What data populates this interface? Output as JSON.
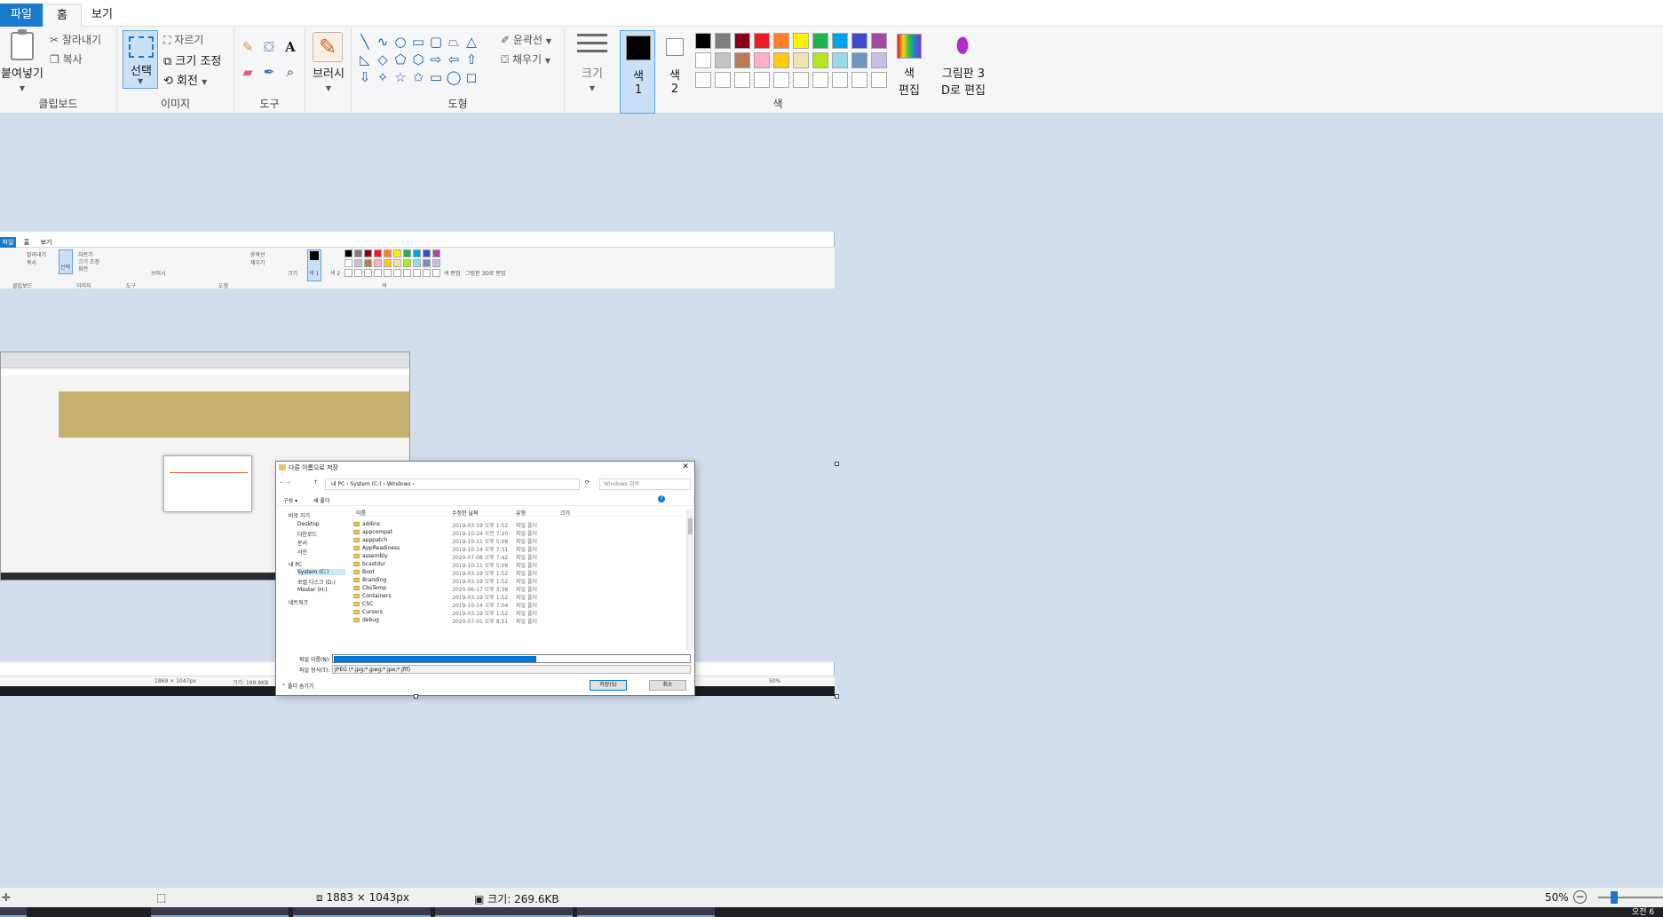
{
  "tabs": {
    "file": "파일",
    "home": "홈",
    "view": "보기"
  },
  "clipboard": {
    "paste": "붙여넣기",
    "cut": "잘라내기",
    "copy": "복사",
    "label": "클립보드"
  },
  "image": {
    "select": "선택",
    "crop": "자르기",
    "resize": "크기 조정",
    "rotate": "회전",
    "label": "이미지"
  },
  "tools": {
    "label": "도구"
  },
  "brushes": {
    "label": "브러시"
  },
  "shapes": {
    "outline": "윤곽선",
    "fill": "채우기",
    "label": "도형",
    "glyphs": [
      "╲",
      "∿",
      "○",
      "▭",
      "▢",
      "⏢",
      "△",
      "◺",
      "◇",
      "⬠",
      "⬡",
      "⇨",
      "⇦",
      "⇧",
      "⇩",
      "✧",
      "☆",
      "✩",
      "▭",
      "◯",
      "◻"
    ]
  },
  "size": {
    "label": "크기"
  },
  "colors": {
    "color1_line1": "색",
    "color1_line2": "1",
    "color2_line1": "색",
    "color2_line2": "2",
    "label": "색",
    "edit_line1": "색",
    "edit_line2": "편집",
    "paint3d_line1": "그림판 3",
    "paint3d_line2": "D로 편집",
    "palette": [
      "#000000",
      "#7f7f7f",
      "#880015",
      "#ed1c24",
      "#ff7f27",
      "#fff200",
      "#22b14c",
      "#00a2e8",
      "#3f48cc",
      "#a349a4",
      "#ffffff",
      "#c3c3c3",
      "#b97a57",
      "#ffaec9",
      "#ffc90e",
      "#efe4b0",
      "#b5e61d",
      "#99d9ea",
      "#7092be",
      "#c8bfe7",
      "#ffffff",
      "#ffffff",
      "#ffffff",
      "#ffffff",
      "#ffffff",
      "#ffffff",
      "#ffffff",
      "#ffffff",
      "#ffffff",
      "#ffffff"
    ]
  },
  "inner_paint": {
    "tabs": [
      "파일",
      "홈",
      "보기"
    ],
    "groups": [
      "클립보드",
      "이미지",
      "도구",
      "도형",
      "색"
    ],
    "labels": [
      "잘라내기",
      "복사",
      "자르기",
      "크기 조정",
      "회전",
      "선택",
      "브러시",
      "윤곽선",
      "채우기",
      "크기",
      "색 1",
      "색 2",
      "색 편집",
      "그림판 3D로 편집"
    ],
    "status_dims": "1869 × 1047px",
    "status_size": "크기: 199.6KB",
    "status_zoom": "50%"
  },
  "save_dialog": {
    "title": "다른 이름으로 저장",
    "breadcrumb": "내 PC  ›  System (C:)  ›  Windows  ›",
    "search_placeholder": "Windows 검색",
    "organize": "구성 ▾",
    "new_folder": "새 폴더",
    "nav_items": [
      "바로 가기",
      "Desktop",
      "다운로드",
      "문서",
      "사진",
      "내 PC",
      "System (C:)",
      "로컬 디스크 (D:)",
      "Master (H:)",
      "네트워크"
    ],
    "columns": {
      "name": "이름",
      "date": "수정한 날짜",
      "type": "유형",
      "size": "크기"
    },
    "files": [
      {
        "name": "addins",
        "date": "2019-03-19 오후 1:52",
        "type": "파일 폴더"
      },
      {
        "name": "appcompat",
        "date": "2019-10-24 오전 7:20",
        "type": "파일 폴더"
      },
      {
        "name": "apppatch",
        "date": "2019-10-11 오후 5:08",
        "type": "파일 폴더"
      },
      {
        "name": "AppReadiness",
        "date": "2019-10-14 오후 7:31",
        "type": "파일 폴더"
      },
      {
        "name": "assembly",
        "date": "2020-07-08 오후 7:42",
        "type": "파일 폴더"
      },
      {
        "name": "bcastdvr",
        "date": "2019-10-11 오후 5:08",
        "type": "파일 폴더"
      },
      {
        "name": "Boot",
        "date": "2019-03-19 오후 1:52",
        "type": "파일 폴더"
      },
      {
        "name": "Branding",
        "date": "2019-03-19 오후 1:52",
        "type": "파일 폴더"
      },
      {
        "name": "CbsTemp",
        "date": "2020-06-17 오후 3:38",
        "type": "파일 폴더"
      },
      {
        "name": "Containers",
        "date": "2019-03-19 오후 1:52",
        "type": "파일 폴더"
      },
      {
        "name": "CSC",
        "date": "2019-10-14 오후 7:04",
        "type": "파일 폴더"
      },
      {
        "name": "Cursors",
        "date": "2019-03-19 오후 1:52",
        "type": "파일 폴더"
      },
      {
        "name": "debug",
        "date": "2020-07-01 오후 8:51",
        "type": "파일 폴더"
      }
    ],
    "filename_label": "파일 이름(N):",
    "filetype_label": "파일 형식(T):",
    "filetype_value": "JPEG (*.jpg;*.jpeg;*.jpe;*.jfif)",
    "hide_folders": "폴더 숨기기",
    "save_button": "저장(S)",
    "cancel_button": "취소"
  },
  "status": {
    "dims": "1883 × 1043px",
    "size": "크기: 269.6KB",
    "zoom": "50%",
    "zoom_level": 0.5
  },
  "taskbar_time": "오전 6"
}
